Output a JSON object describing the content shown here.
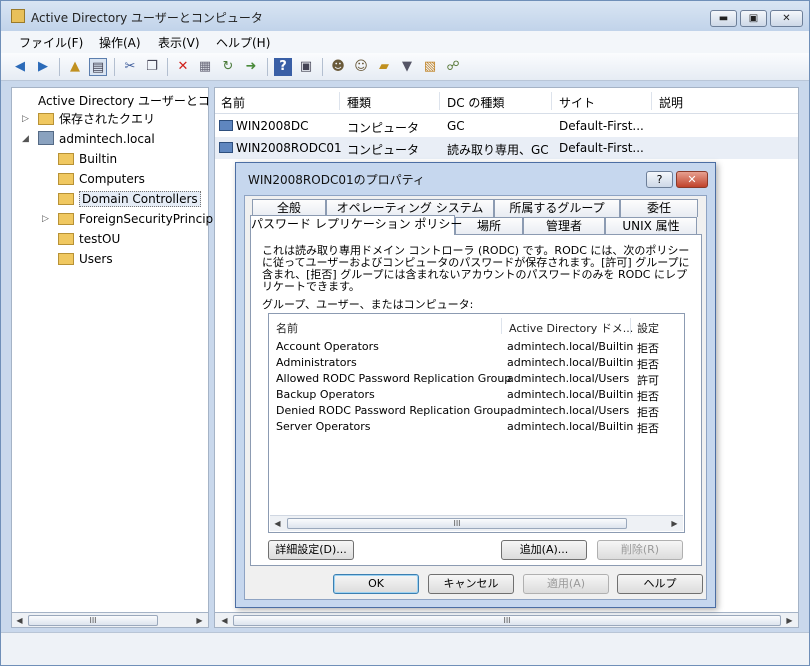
{
  "window": {
    "title": "Active Directory ユーザーとコンピュータ",
    "min_glyph": "▬",
    "max_glyph": "▣",
    "close_glyph": "✕"
  },
  "menu": [
    "ファイル(F)",
    "操作(A)",
    "表示(V)",
    "ヘルプ(H)"
  ],
  "toolbar_icons": [
    "back-icon",
    "forward-icon",
    "up-folder-icon",
    "console-tree-icon",
    "cut-icon",
    "copy-icon",
    "delete-icon",
    "properties-icon",
    "refresh-icon",
    "export-icon",
    "help-icon",
    "view-icon",
    "users-icon",
    "group-icon",
    "ou-icon",
    "filter-icon",
    "find-icon",
    "add-to-group-icon"
  ],
  "tree": {
    "root": "Active Directory ユーザーとコ",
    "items": [
      {
        "label": "保存されたクエリ"
      },
      {
        "label": "admintech.local"
      },
      {
        "label": "Builtin"
      },
      {
        "label": "Computers"
      },
      {
        "label": "Domain Controllers"
      },
      {
        "label": "ForeignSecurityPrincip"
      },
      {
        "label": "testOU"
      },
      {
        "label": "Users"
      }
    ]
  },
  "list": {
    "columns": [
      "名前",
      "種類",
      "DC の種類",
      "サイト",
      "説明"
    ],
    "rows": [
      {
        "name": "WIN2008DC",
        "type": "コンピュータ",
        "dc_type": "GC",
        "site": "Default-First..."
      },
      {
        "name": "WIN2008RODC01",
        "type": "コンピュータ",
        "dc_type": "読み取り専用、GC",
        "site": "Default-First..."
      }
    ]
  },
  "dialog": {
    "title": "WIN2008RODC01のプロパティ",
    "help_glyph": "?",
    "close_glyph": "✕",
    "tabs_row1": [
      "全般",
      "オペレーティング システム",
      "所属するグループ",
      "委任"
    ],
    "tabs_row2": [
      "パスワード レプリケーション ポリシー",
      "場所",
      "管理者",
      "UNIX 属性"
    ],
    "description": "これは読み取り専用ドメイン コントローラ (RODC) です。RODC には、次のポリシーに従ってユーザーおよびコンピュータのパスワードが保存されます。[許可] グループに含まれ、[拒否] グループには含まれないアカウントのパスワードのみを RODC にレプリケートできます。",
    "group_label": "グループ、ユーザー、またはコンピュータ:",
    "columns": [
      "名前",
      "Active Directory ドメ...",
      "設定"
    ],
    "entries": [
      {
        "name": "Account Operators",
        "domain": "admintech.local/Builtin",
        "setting": "拒否"
      },
      {
        "name": "Administrators",
        "domain": "admintech.local/Builtin",
        "setting": "拒否"
      },
      {
        "name": "Allowed RODC Password Replication Group",
        "domain": "admintech.local/Users",
        "setting": "許可"
      },
      {
        "name": "Backup Operators",
        "domain": "admintech.local/Builtin",
        "setting": "拒否"
      },
      {
        "name": "Denied RODC Password Replication Group",
        "domain": "admintech.local/Users",
        "setting": "拒否"
      },
      {
        "name": "Server Operators",
        "domain": "admintech.local/Builtin",
        "setting": "拒否"
      }
    ],
    "advanced_btn": "詳細設定(D)...",
    "add_btn": "追加(A)...",
    "remove_btn": "削除(R)",
    "ok_btn": "OK",
    "cancel_btn": "キャンセル",
    "apply_btn": "適用(A)",
    "help_btn": "ヘルプ",
    "scroll_thumb": "III"
  }
}
